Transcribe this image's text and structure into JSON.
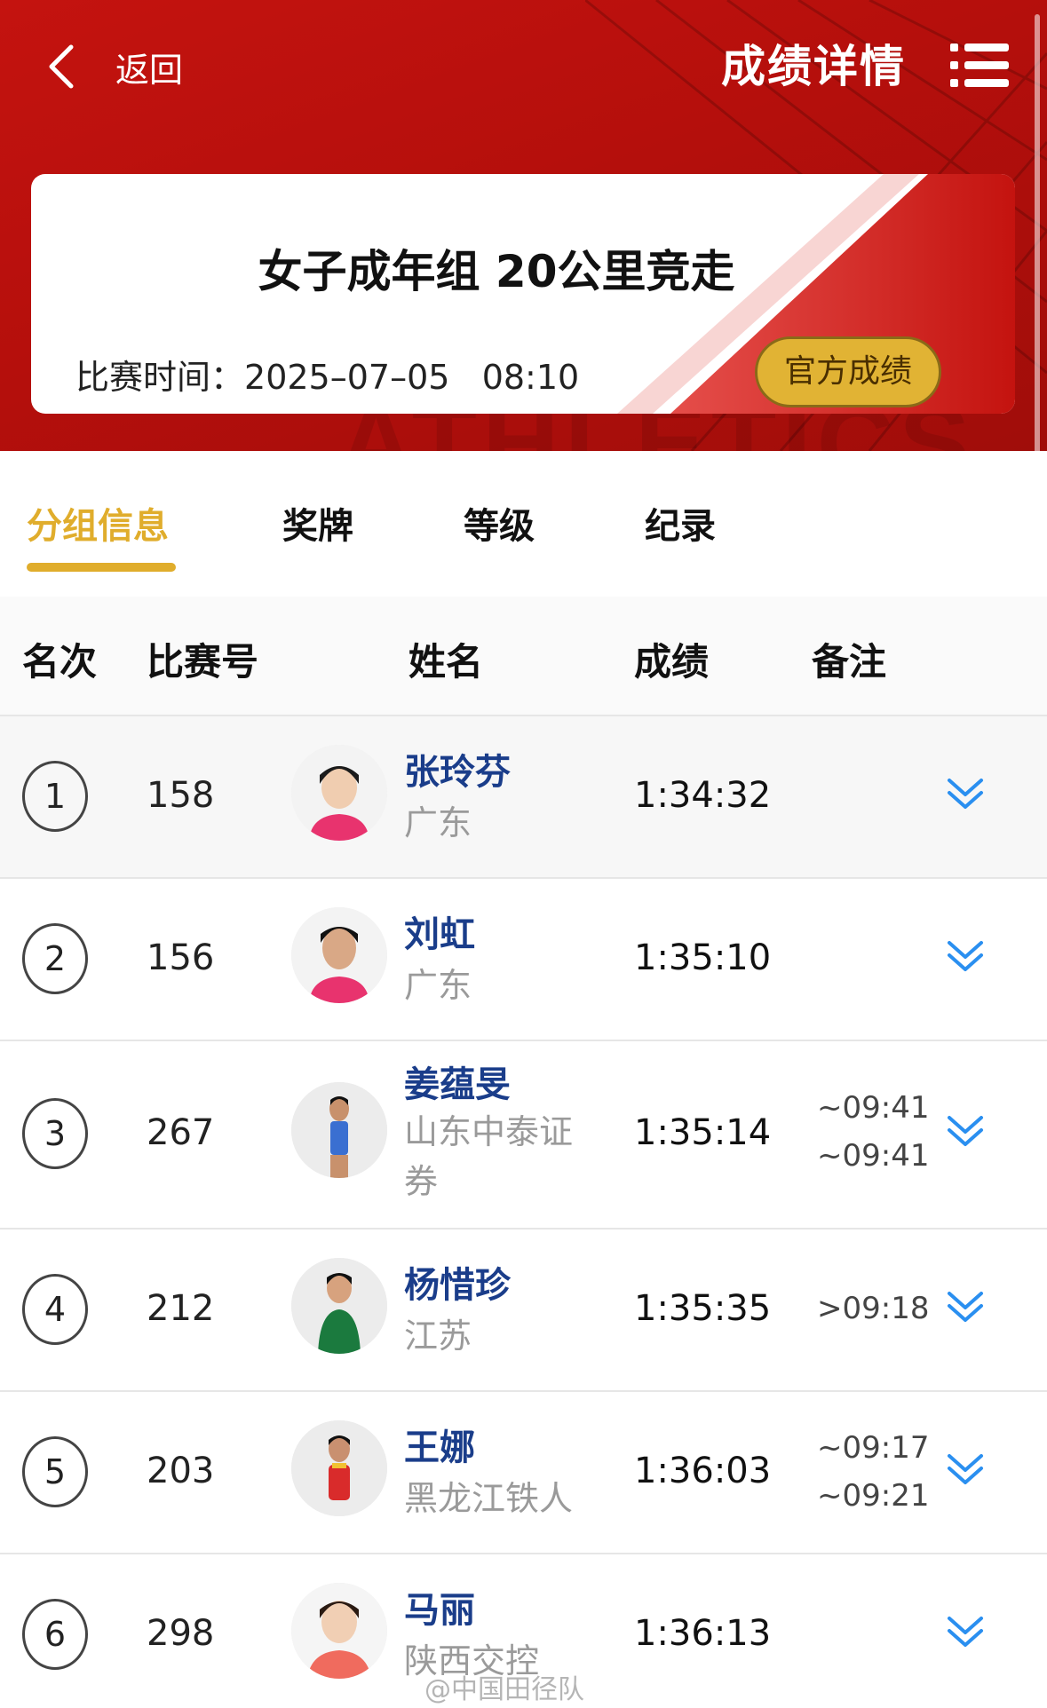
{
  "header": {
    "back_label": "返回",
    "title": "成绩详情",
    "watermark": "ATHLETICS"
  },
  "event": {
    "title": "女子成年组 20公里竞走",
    "time_label": "比赛时间：",
    "date": "2025–07–05",
    "time": "08:10",
    "official_button": "官方成绩"
  },
  "tabs": [
    {
      "label": "分组信息",
      "active": true
    },
    {
      "label": "奖牌",
      "active": false
    },
    {
      "label": "等级",
      "active": false
    },
    {
      "label": "纪录",
      "active": false
    }
  ],
  "table": {
    "headers": [
      "名次",
      "比赛号",
      "姓名",
      "成绩",
      "备注"
    ],
    "rows": [
      {
        "rank": "1",
        "bib": "158",
        "name": "张玲芬",
        "team": "广东",
        "result": "1:34:32",
        "notes": []
      },
      {
        "rank": "2",
        "bib": "156",
        "name": "刘虹",
        "team": "广东",
        "result": "1:35:10",
        "notes": []
      },
      {
        "rank": "3",
        "bib": "267",
        "name": "姜蕴旻",
        "team": "山东中泰证券",
        "result": "1:35:14",
        "notes": [
          "~09:41",
          "~09:41"
        ]
      },
      {
        "rank": "4",
        "bib": "212",
        "name": "杨惜珍",
        "team": "江苏",
        "result": "1:35:35",
        "notes": [
          ">09:18"
        ]
      },
      {
        "rank": "5",
        "bib": "203",
        "name": "王娜",
        "team": "黑龙江铁人",
        "result": "1:36:03",
        "notes": [
          "~09:17",
          "~09:21"
        ]
      },
      {
        "rank": "6",
        "bib": "298",
        "name": "马丽",
        "team": "陕西交控",
        "result": "1:36:13",
        "notes": []
      }
    ]
  },
  "watermark_footer": "@中国田径队",
  "colors": {
    "header_red": "#c4130f",
    "gold": "#e0ad2c",
    "name_blue": "#1a3d8a",
    "expand_blue": "#2a8ff0"
  },
  "icons": {
    "back": "chevron-left-icon",
    "menu": "list-menu-icon",
    "expand": "double-chevron-down-icon"
  }
}
